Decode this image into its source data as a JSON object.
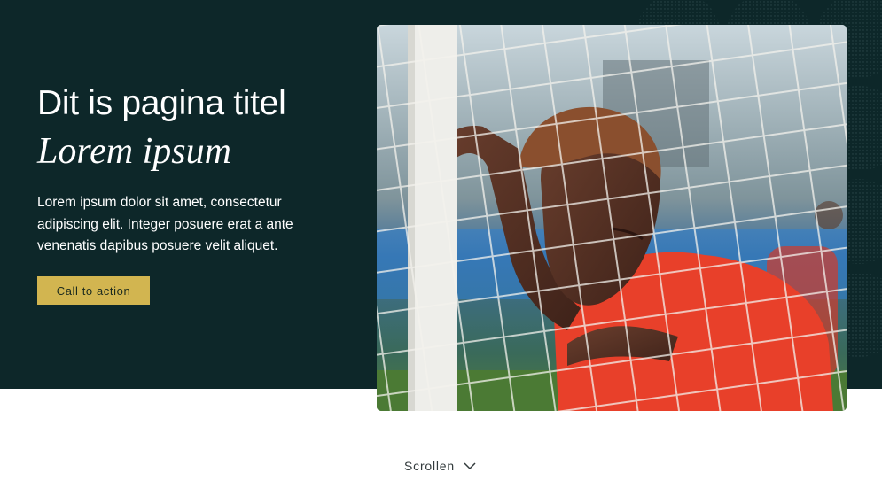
{
  "hero": {
    "title": "Dit is pagina titel",
    "subtitle": "Lorem ipsum",
    "intro": "Lorem ipsum dolor sit amet, consectetur adipiscing elit. Integer posuere erat a ante venenatis dapibus posuere velit aliquet.",
    "cta_label": "Call to action",
    "image_icon": "photo-football-player-behind-goal-net"
  },
  "scroll": {
    "label": "Scrollen",
    "icon": "chevron-down-icon"
  },
  "colors": {
    "hero_background": "#0d2729",
    "cta_background": "#d2b550",
    "page_background": "#ffffff"
  }
}
